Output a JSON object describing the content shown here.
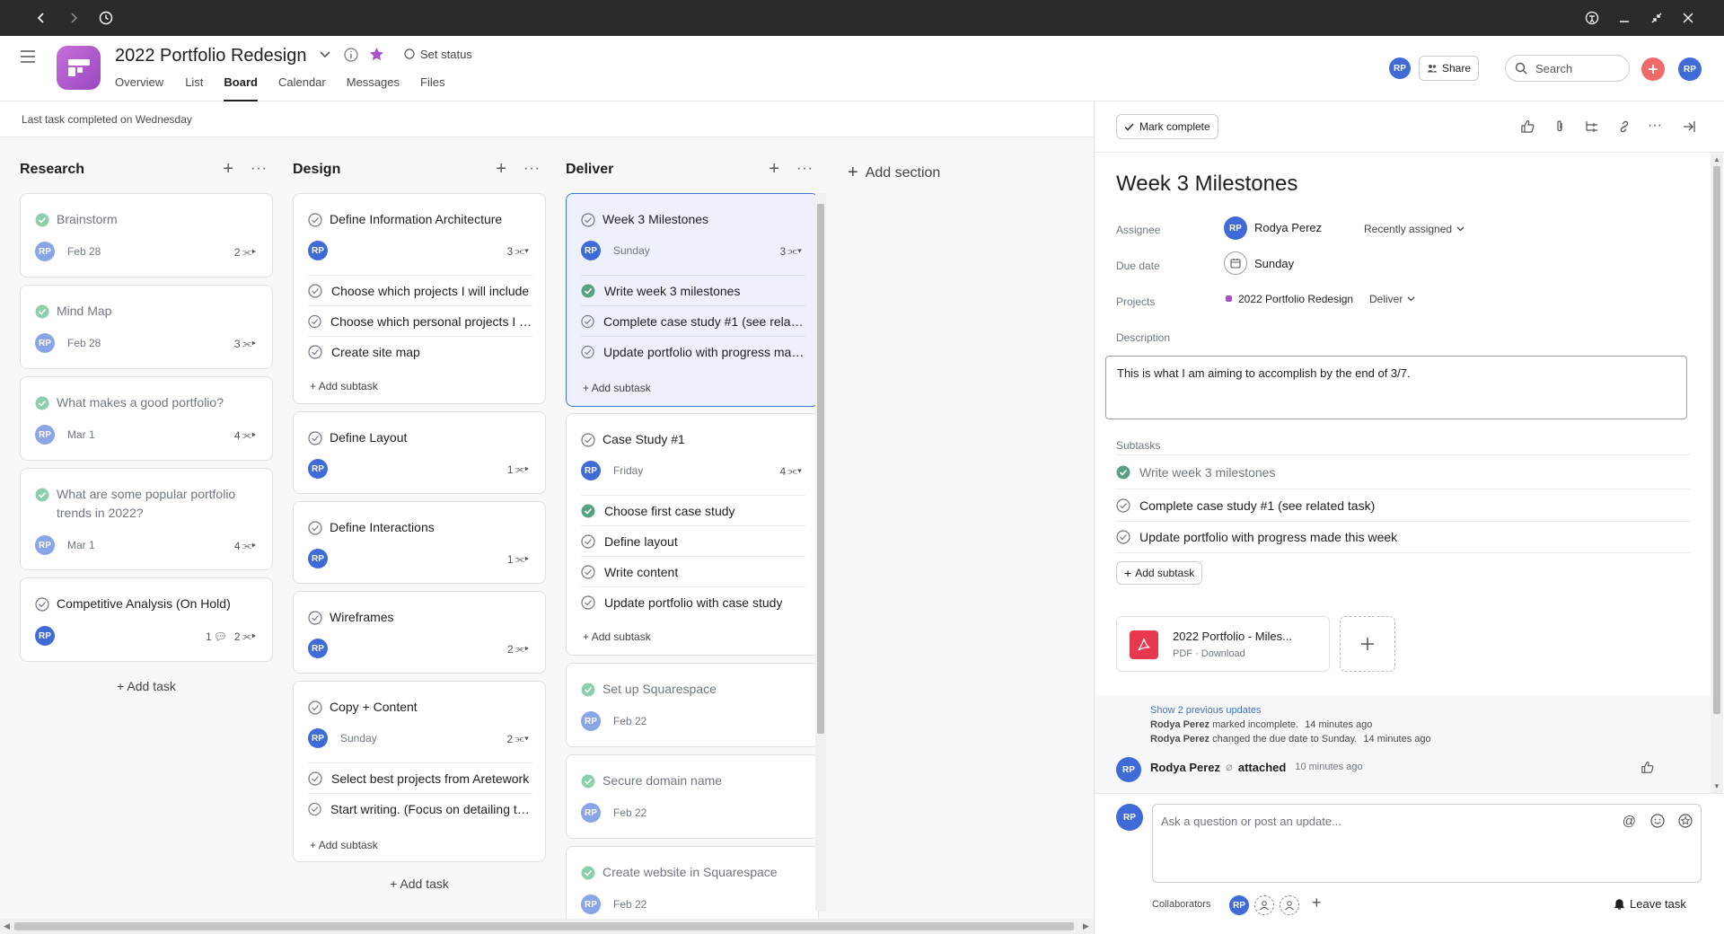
{
  "header": {
    "project_title": "2022 Portfolio Redesign",
    "set_status": "Set status",
    "tabs": [
      "Overview",
      "List",
      "Board",
      "Calendar",
      "Messages",
      "Files"
    ],
    "active_tab": "Board",
    "share_label": "Share",
    "search_placeholder": "Search",
    "avatar_initials": "RP",
    "project_color": "#a94fc7"
  },
  "subbar": {
    "status_text": "Last task completed on Wednesday"
  },
  "board": {
    "add_section_label": "Add section",
    "add_task_label": "Add task",
    "add_subtask_label": "Add subtask",
    "columns": [
      {
        "name": "Research",
        "cards": [
          {
            "title": "Brainstorm",
            "done": true,
            "date": "Feb 28",
            "subtasks": "2"
          },
          {
            "title": "Mind Map",
            "done": true,
            "date": "Feb 28",
            "subtasks": "3"
          },
          {
            "title": "What makes a good portfolio?",
            "done": true,
            "date": "Mar 1",
            "subtasks": "4"
          },
          {
            "title": "What are some popular portfolio trends in 2022?",
            "done": true,
            "date": "Mar 1",
            "subtasks": "4"
          },
          {
            "title": "Competitive Analysis (On Hold)",
            "done": false,
            "date": "",
            "comments": "1",
            "subtasks": "2"
          }
        ]
      },
      {
        "name": "Design",
        "cards": [
          {
            "title": "Define Information Architecture",
            "done": false,
            "date": "",
            "subtasks": "3",
            "subtask_items": [
              "Choose which projects I will include",
              "Choose which personal projects I will include",
              "Create site map"
            ]
          },
          {
            "title": "Define Layout",
            "done": false,
            "date": "",
            "subtasks": "1"
          },
          {
            "title": "Define Interactions",
            "done": false,
            "date": "",
            "subtasks": "1"
          },
          {
            "title": "Wireframes",
            "done": false,
            "date": "",
            "subtasks": "2"
          },
          {
            "title": "Copy + Content",
            "done": false,
            "date": "Sunday",
            "subtasks": "2",
            "subtask_items": [
              "Select best projects from Aretework",
              "Start writing. (Focus on detailing the process)"
            ]
          }
        ]
      },
      {
        "name": "Deliver",
        "cards": [
          {
            "title": "Week 3 Milestones",
            "done": false,
            "date": "Sunday",
            "subtasks": "3",
            "selected": true,
            "subtask_items": [
              "Write week 3 milestones",
              "Complete case study #1 (see related task)",
              "Update portfolio with progress made this week"
            ],
            "subtask_done": [
              true,
              false,
              false
            ]
          },
          {
            "title": "Case Study #1",
            "done": false,
            "date": "Friday",
            "subtasks": "4",
            "subtask_items": [
              "Choose first case study",
              "Define layout",
              "Write content",
              "Update portfolio with case study"
            ],
            "subtask_done": [
              true,
              false,
              false,
              false
            ]
          },
          {
            "title": "Set up Squarespace",
            "done": true,
            "date": "Feb 22"
          },
          {
            "title": "Secure domain name",
            "done": true,
            "date": "Feb 22"
          },
          {
            "title": "Create website in Squarespace",
            "done": true,
            "date": "Feb 22"
          }
        ]
      }
    ]
  },
  "panel": {
    "mark_complete": "Mark complete",
    "task_title": "Week 3 Milestones",
    "assignee_label": "Assignee",
    "assignee_name": "Rodya Perez",
    "recently_assigned": "Recently assigned",
    "due_date_label": "Due date",
    "due_date": "Sunday",
    "projects_label": "Projects",
    "project_name": "2022 Portfolio Redesign",
    "project_section": "Deliver",
    "description_label": "Description",
    "description": "This is what I am aiming to accomplish by the end of 3/7.",
    "subtasks_label": "Subtasks",
    "subtasks": [
      "Write week 3 milestones",
      "Complete case study #1 (see related task)",
      "Update portfolio with progress made this week"
    ],
    "subtask_done": [
      true,
      false,
      false
    ],
    "add_subtask": "Add subtask",
    "attachment_name": "2022 Portfolio - Miles...",
    "attachment_meta": "PDF · Download",
    "show_updates": "Show 2 previous updates",
    "update_1_name": "Rodya Perez",
    "update_1_text": "marked incomplete.",
    "update_1_time": "14 minutes ago",
    "update_2_name": "Rodya Perez",
    "update_2_text": "changed the due date to Sunday.",
    "update_2_time": "14 minutes ago",
    "story_name": "Rodya Perez",
    "story_action": "attached",
    "story_time": "10 minutes ago",
    "comment_placeholder": "Ask a question or post an update...",
    "collaborators_label": "Collaborators",
    "leave_task": "Leave task"
  }
}
